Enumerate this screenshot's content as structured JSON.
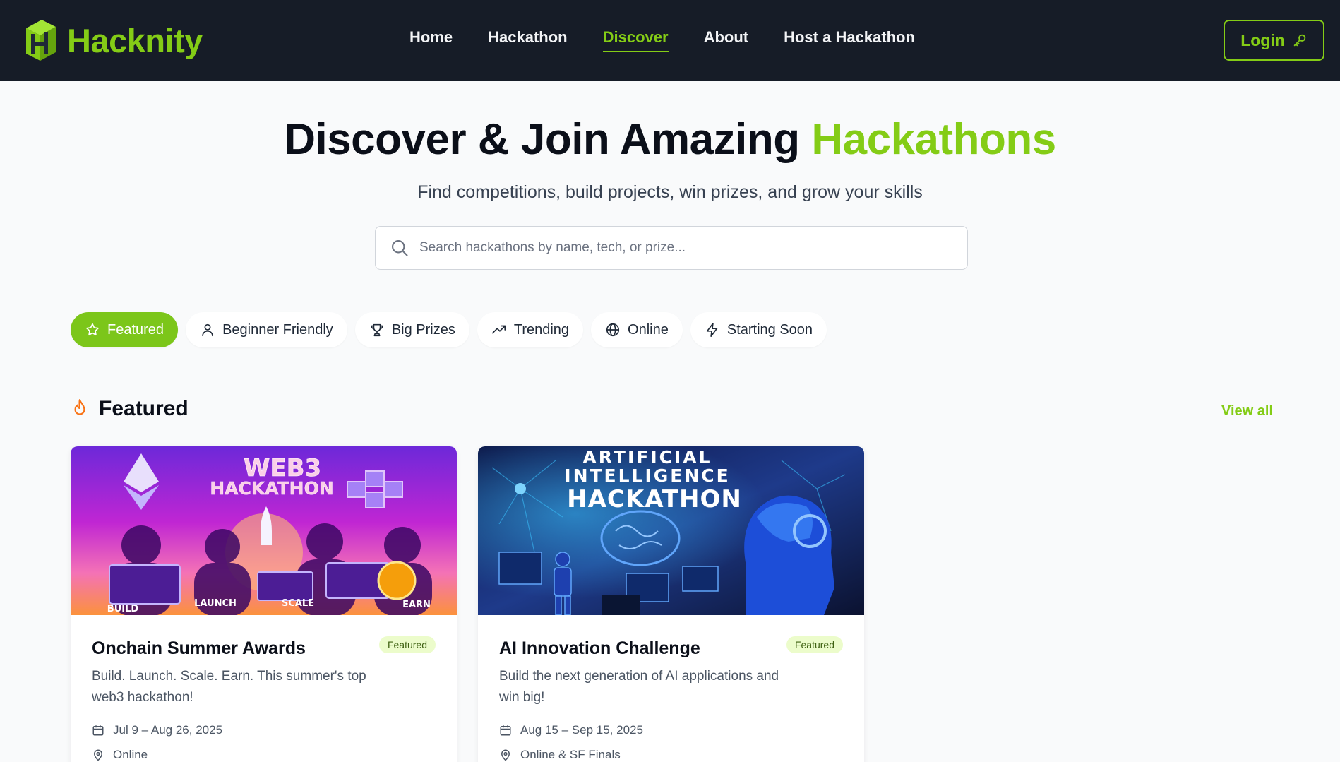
{
  "brand": {
    "name": "Hacknity"
  },
  "nav": {
    "links": [
      "Home",
      "Hackathon",
      "Discover",
      "About",
      "Host a Hackathon"
    ],
    "active": "Discover",
    "login_label": "Login"
  },
  "hero": {
    "title_main": "Discover & Join Amazing",
    "title_accent": "Hackathons",
    "subtitle": "Find competitions, build projects, win prizes, and grow your skills"
  },
  "search": {
    "placeholder": "Search hackathons by name, tech, or prize...",
    "value": ""
  },
  "filters": [
    {
      "label": "Featured",
      "icon": "star-icon",
      "active": true
    },
    {
      "label": "Beginner Friendly",
      "icon": "user-icon",
      "active": false
    },
    {
      "label": "Big Prizes",
      "icon": "trophy-icon",
      "active": false
    },
    {
      "label": "Trending",
      "icon": "trending-icon",
      "active": false
    },
    {
      "label": "Online",
      "icon": "globe-icon",
      "active": false
    },
    {
      "label": "Starting Soon",
      "icon": "lightning-icon",
      "active": false
    }
  ],
  "section": {
    "title": "Featured",
    "icon": "flame-icon",
    "view_all": "View all"
  },
  "cards": [
    {
      "banner": {
        "line1": "WEB3",
        "line2": "HACKATHON",
        "captions": [
          "BUILD",
          "LAUNCH",
          "SCALE",
          "EARN"
        ]
      },
      "title": "Onchain Summer Awards",
      "badge": "Featured",
      "description": "Build. Launch. Scale. Earn. This summer's top web3 hackathon!",
      "date": "Jul 9 – Aug 26, 2025",
      "location": "Online"
    },
    {
      "banner": {
        "line1": "ARTIFICIAL",
        "line2": "INTELLIGENCE",
        "line3": "HACKATHON"
      },
      "title": "AI Innovation Challenge",
      "badge": "Featured",
      "description": "Build the next generation of AI applications and win big!",
      "date": "Aug 15 – Sep 15, 2025",
      "location": "Online & SF Finals"
    }
  ],
  "colors": {
    "accent": "#84cc16",
    "navbar": "#161c27",
    "background": "#f9fafb"
  }
}
